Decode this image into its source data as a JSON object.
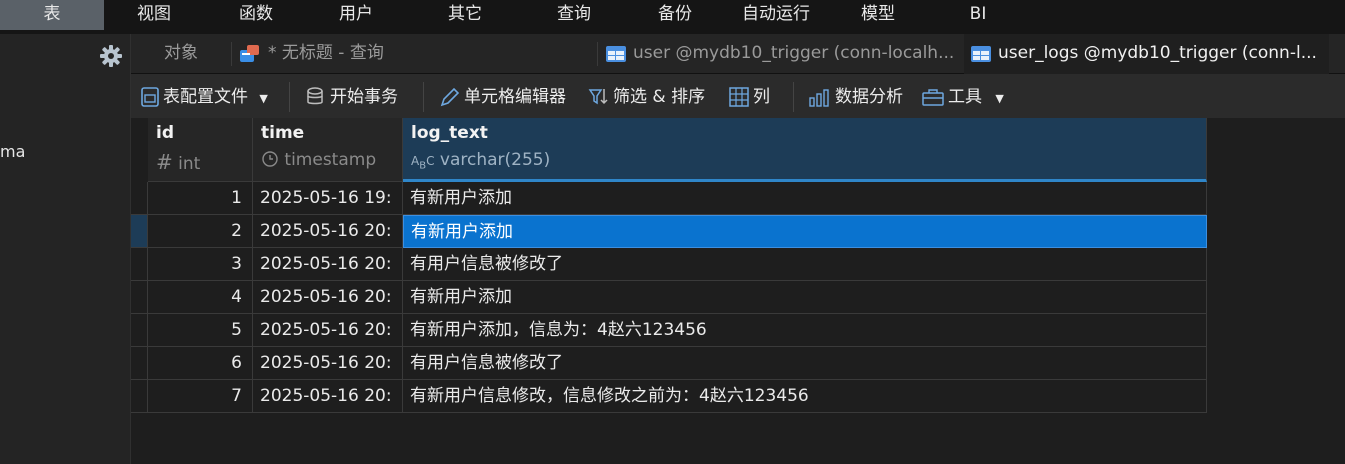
{
  "menu": [
    {
      "label": "表",
      "active": true
    },
    {
      "label": "视图"
    },
    {
      "label": "函数"
    },
    {
      "label": "用户"
    },
    {
      "label": "其它"
    },
    {
      "label": "查询"
    },
    {
      "label": "备份"
    },
    {
      "label": "自动运行"
    },
    {
      "label": "模型"
    },
    {
      "label": "BI"
    }
  ],
  "left_panel": {
    "partial_text": "ma",
    "settings_icon": "gear-icon"
  },
  "tabs": [
    {
      "label": "对象"
    },
    {
      "label": "* 无标题 - 查询",
      "icon": "query-icon"
    },
    {
      "label": "user @mydb10_trigger (conn-localh...",
      "icon": "table-icon"
    },
    {
      "label": "user_logs @mydb10_trigger (conn-l...",
      "icon": "table-icon",
      "active": true
    }
  ],
  "toolbar": {
    "profile": "表配置文件",
    "begin_tx": "开始事务",
    "cell_editor": "单元格编辑器",
    "filter_sort": "筛选 & 排序",
    "columns": "列",
    "analysis": "数据分析",
    "tools": "工具"
  },
  "columns": [
    {
      "name": "id",
      "type": "int",
      "type_icon": "hash-icon"
    },
    {
      "name": "time",
      "type": "timestamp",
      "type_icon": "clock-icon"
    },
    {
      "name": "log_text",
      "type": "varchar(255)",
      "type_icon": "text-type-icon",
      "selected": true
    }
  ],
  "rows": [
    {
      "id": "1",
      "time": "2025-05-16 19:",
      "log_text": "有新用户添加"
    },
    {
      "id": "2",
      "time": "2025-05-16 20:",
      "log_text": "有新用户添加"
    },
    {
      "id": "3",
      "time": "2025-05-16 20:",
      "log_text": "有用户信息被修改了"
    },
    {
      "id": "4",
      "time": "2025-05-16 20:",
      "log_text": "有新用户添加"
    },
    {
      "id": "5",
      "time": "2025-05-16 20:",
      "log_text": "有新用户添加，信息为：4赵六123456"
    },
    {
      "id": "6",
      "time": "2025-05-16 20:",
      "log_text": "有用户信息被修改了"
    },
    {
      "id": "7",
      "time": "2025-05-16 20:",
      "log_text": "有新用户信息修改，信息修改之前为：4赵六123456"
    }
  ],
  "current_row": 2,
  "colors": {
    "selection": "#0a73cf",
    "header_selected": "#1d3c57",
    "accent": "#2f86c9"
  }
}
